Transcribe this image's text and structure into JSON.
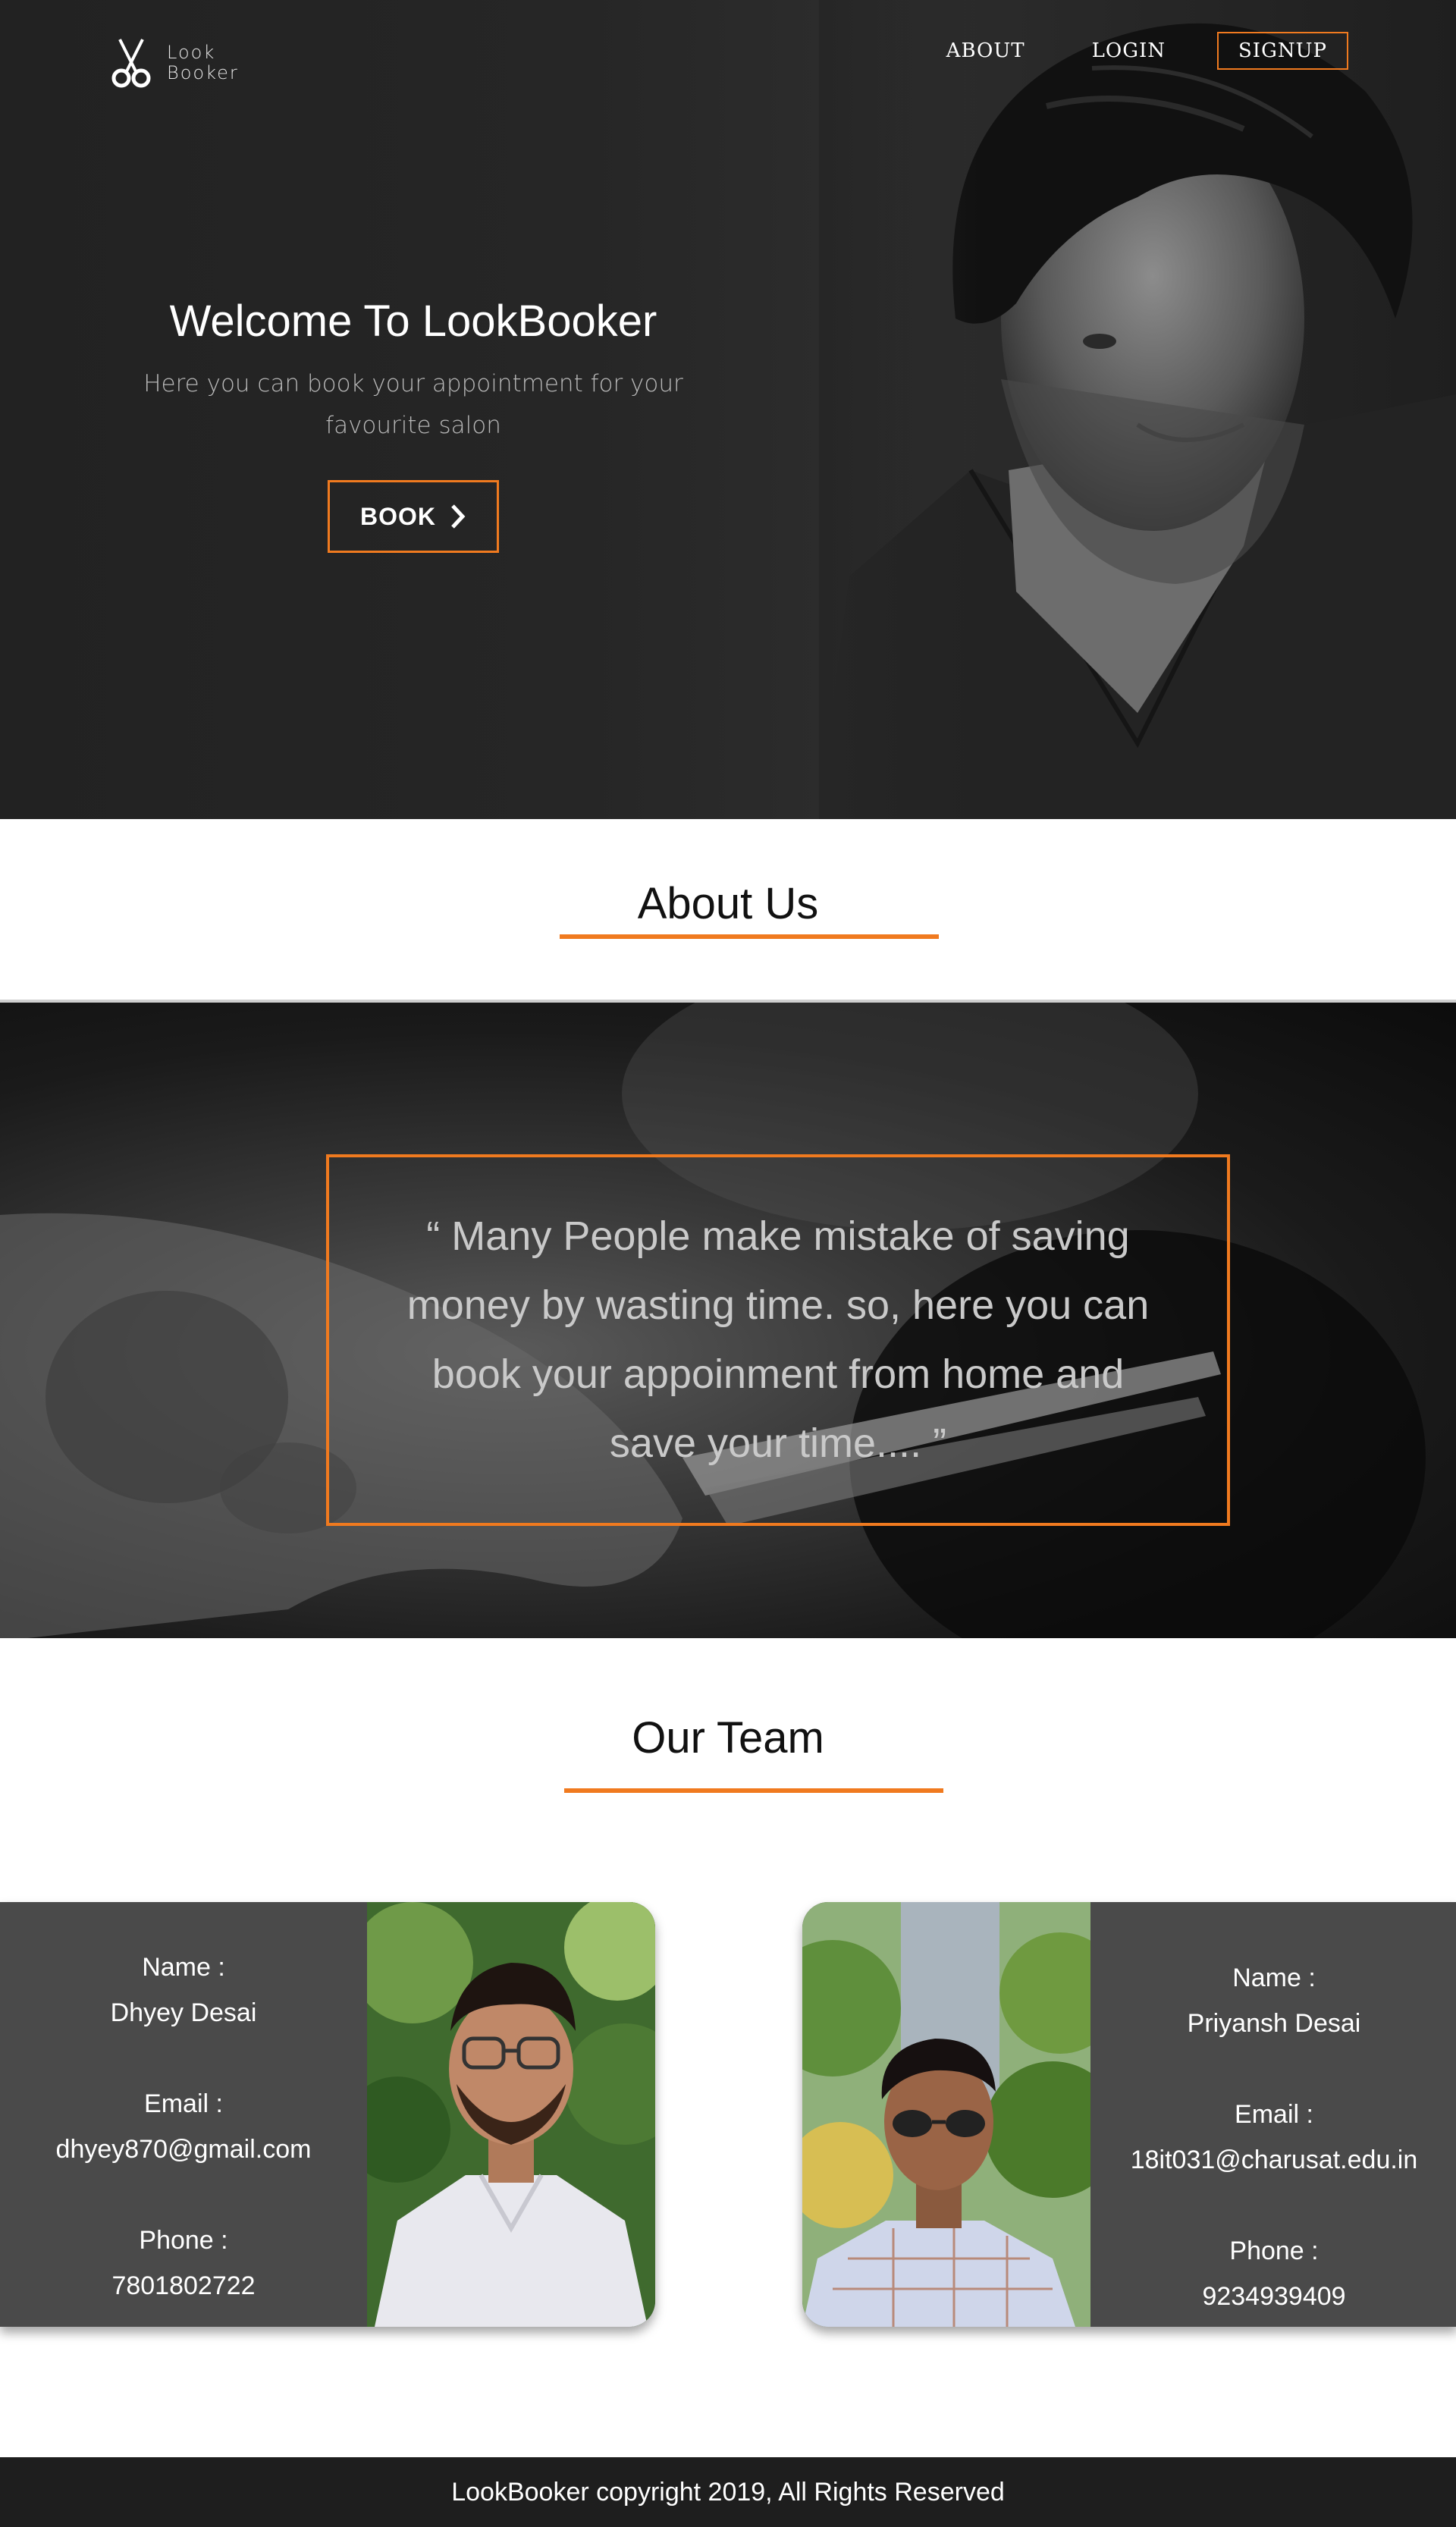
{
  "logo": {
    "line1": "Look",
    "line2": "Booker"
  },
  "nav": {
    "about": "ABOUT",
    "login": "LOGIN",
    "signup": "SIGNUP"
  },
  "hero": {
    "title": "Welcome To LookBooker",
    "subtitle": "Here you can book your appointment for your favourite salon",
    "book_label": "BOOK"
  },
  "about": {
    "heading": "About Us",
    "quote": "“ Many People make mistake of saving money by wasting time. so, here you can book your appoinment from home and save your time.... ”"
  },
  "team": {
    "heading": "Our Team",
    "members": [
      {
        "name_label": "Name :",
        "name": "Dhyey Desai",
        "email_label": "Email :",
        "email": "dhyey870@gmail.com",
        "phone_label": "Phone :",
        "phone": "7801802722"
      },
      {
        "name_label": "Name :",
        "name": "Priyansh Desai",
        "email_label": "Email :",
        "email": "18it031@charusat.edu.in",
        "phone_label": "Phone :",
        "phone": "9234939409"
      }
    ]
  },
  "footer": {
    "text": "LookBooker copyright 2019, All Rights Reserved"
  },
  "colors": {
    "accent": "#f07a1f",
    "card_bg": "#4a4a4a",
    "footer_bg": "#1e1e1e"
  },
  "icons": {
    "logo": "scissors-icon",
    "book": "chevron-right-icon"
  }
}
